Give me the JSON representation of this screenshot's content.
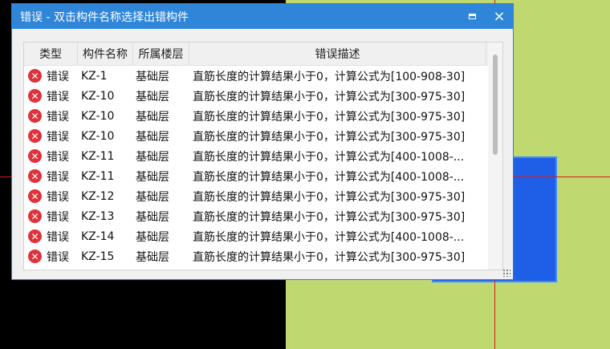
{
  "dialog": {
    "title": "错误 - 双击构件名称选择出错构件",
    "maximize_label": "",
    "close_label": "×"
  },
  "table": {
    "columns": [
      "类型",
      "构件名称",
      "所属楼层",
      "错误描述"
    ],
    "rows": [
      {
        "type": "错误",
        "name": "KZ-1",
        "floor": "基础层",
        "desc": "直筋长度的计算结果小于0，计算公式为[100-908-30]"
      },
      {
        "type": "错误",
        "name": "KZ-10",
        "floor": "基础层",
        "desc": "直筋长度的计算结果小于0，计算公式为[300-975-30]"
      },
      {
        "type": "错误",
        "name": "KZ-10",
        "floor": "基础层",
        "desc": "直筋长度的计算结果小于0，计算公式为[300-975-30]"
      },
      {
        "type": "错误",
        "name": "KZ-10",
        "floor": "基础层",
        "desc": "直筋长度的计算结果小于0，计算公式为[300-975-30]"
      },
      {
        "type": "错误",
        "name": "KZ-11",
        "floor": "基础层",
        "desc": "直筋长度的计算结果小于0，计算公式为[400-1008-..."
      },
      {
        "type": "错误",
        "name": "KZ-11",
        "floor": "基础层",
        "desc": "直筋长度的计算结果小于0，计算公式为[400-1008-..."
      },
      {
        "type": "错误",
        "name": "KZ-12",
        "floor": "基础层",
        "desc": "直筋长度的计算结果小于0，计算公式为[300-975-30]"
      },
      {
        "type": "错误",
        "name": "KZ-13",
        "floor": "基础层",
        "desc": "直筋长度的计算结果小于0，计算公式为[300-975-30]"
      },
      {
        "type": "错误",
        "name": "KZ-14",
        "floor": "基础层",
        "desc": "直筋长度的计算结果小于0，计算公式为[400-1008-..."
      },
      {
        "type": "错误",
        "name": "KZ-15",
        "floor": "基础层",
        "desc": "直筋长度的计算结果小于0，计算公式为[300-975-30]"
      }
    ]
  },
  "icons": {
    "error": "error-circle-x-icon",
    "maximize": "maximize-icon",
    "close": "close-icon",
    "resize": "resize-grip-icon"
  },
  "colors": {
    "titlebar": "#2f86d8",
    "error_icon": "#e0323a",
    "cad_green": "#c0d870",
    "cad_blue": "#1f5fe8",
    "cad_line": "#d02020"
  }
}
